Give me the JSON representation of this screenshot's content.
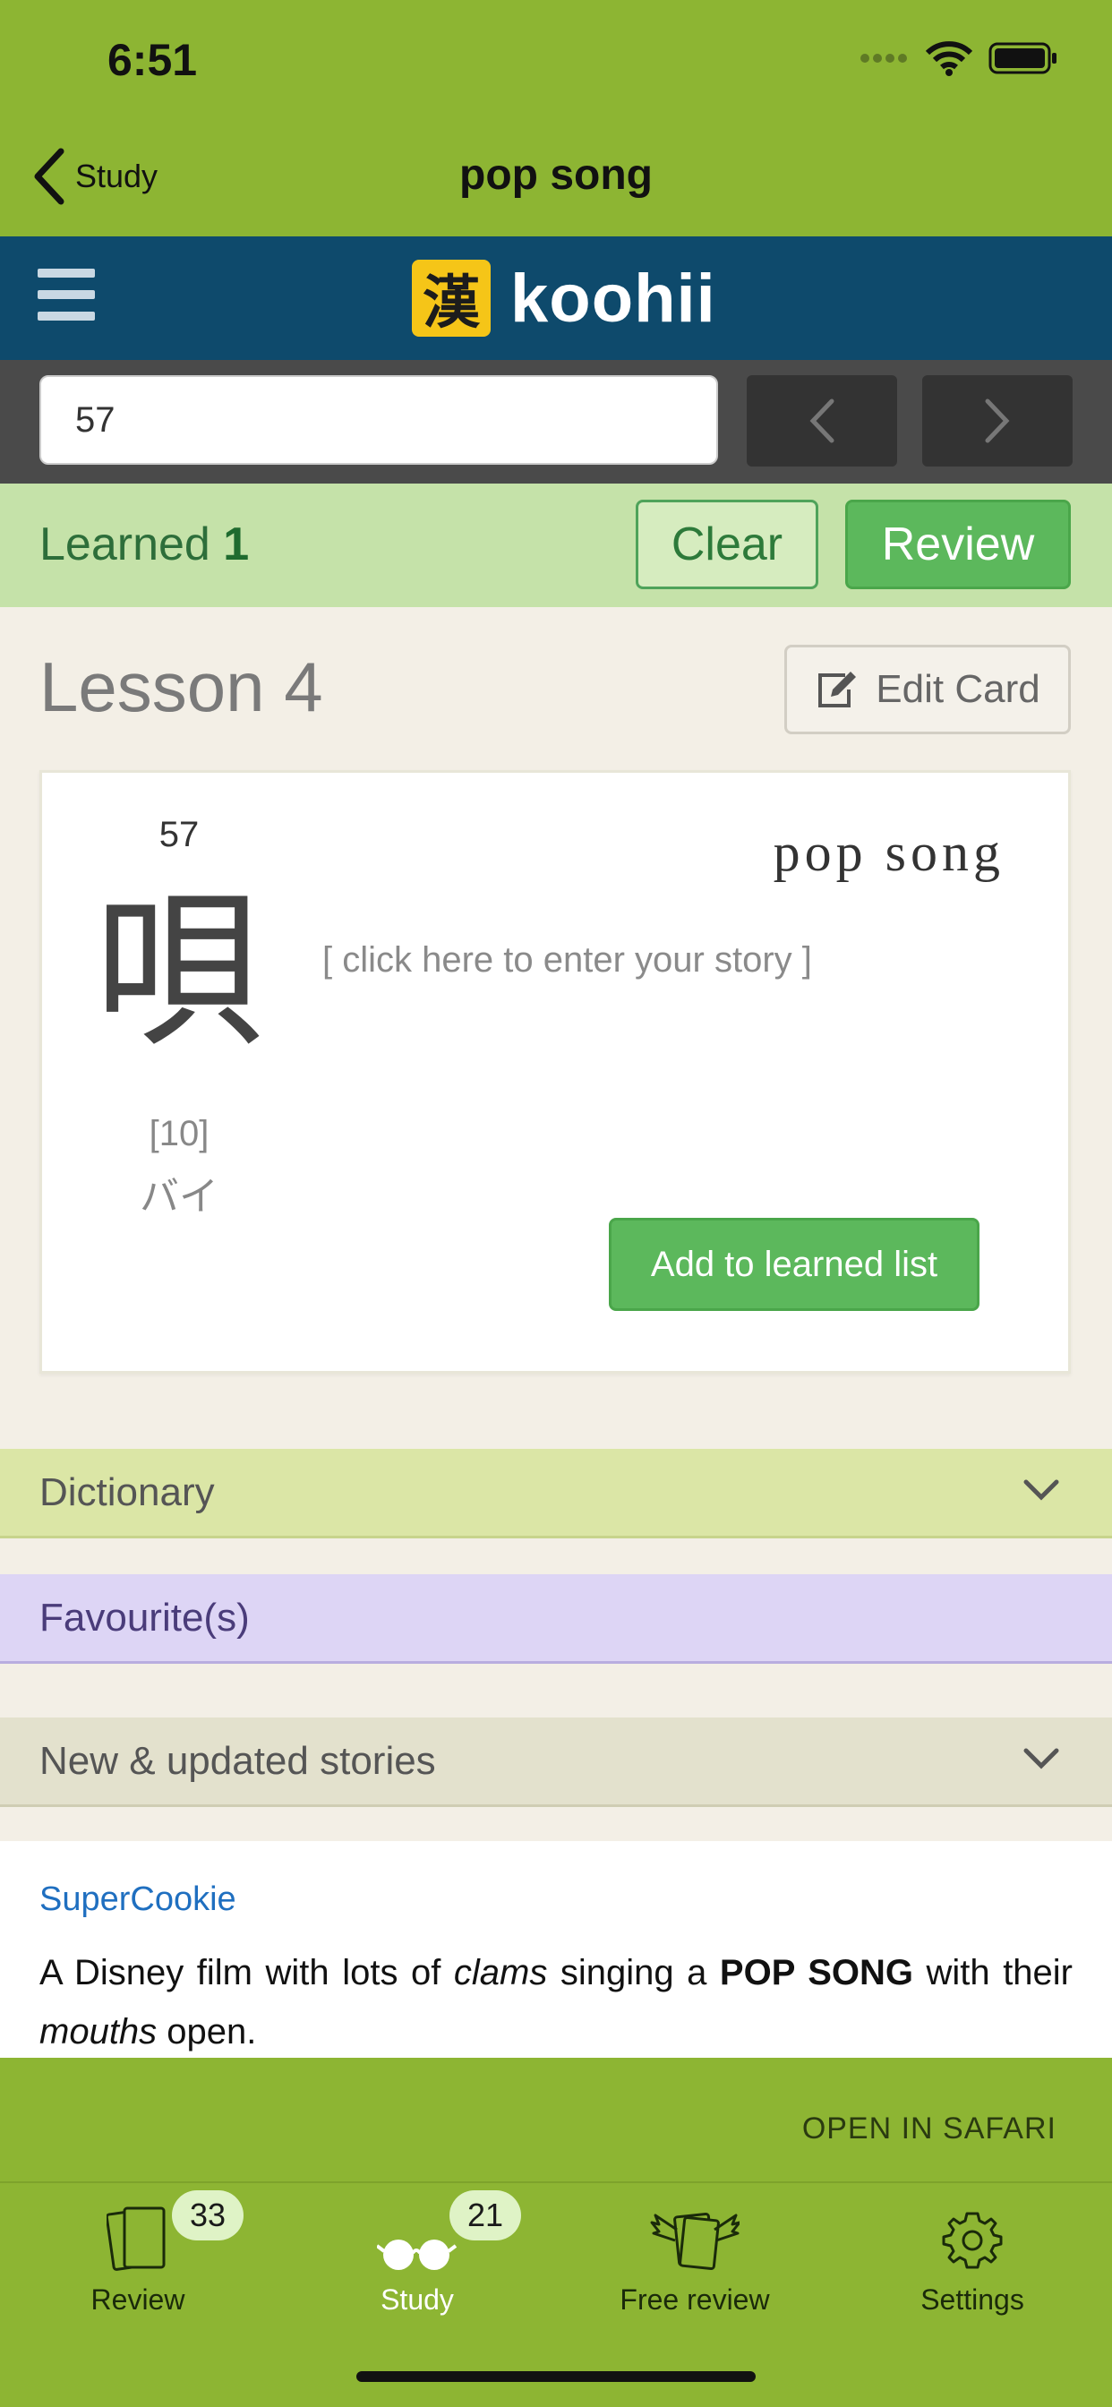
{
  "status_bar": {
    "time": "6:51"
  },
  "nav": {
    "back_label": "Study",
    "title": "pop song"
  },
  "header": {
    "logo_kanji": "漢",
    "logo_text": "koohii"
  },
  "search": {
    "value": "57"
  },
  "learned": {
    "label": "Learned",
    "count": "1",
    "clear_label": "Clear",
    "review_label": "Review"
  },
  "lesson": {
    "title": "Lesson 4",
    "edit_label": "Edit Card"
  },
  "card": {
    "number": "57",
    "kanji": "唄",
    "stroke_count": "[10]",
    "reading": "バイ",
    "keyword": "pop song",
    "story_prompt": "[ click here to enter your story ]",
    "add_label": "Add to learned list"
  },
  "sections": {
    "dictionary": "Dictionary",
    "favourites": "Favourite(s)",
    "stories": "New & updated stories"
  },
  "story": {
    "author": "SuperCookie",
    "text_1": "A Disney film with lots of ",
    "text_2": "clams",
    "text_3": " singing a ",
    "text_4": "POP SONG",
    "text_5": " with their ",
    "text_6": "mouths",
    "text_7": " open."
  },
  "bottom": {
    "open_safari": "OPEN IN SAFARI"
  },
  "tabs": [
    {
      "label": "Review",
      "badge": "33",
      "icon": "cards-icon"
    },
    {
      "label": "Study",
      "badge": "21",
      "icon": "glasses-icon"
    },
    {
      "label": "Free review",
      "icon": "flying-cards-icon"
    },
    {
      "label": "Settings",
      "icon": "gear-icon"
    }
  ],
  "colors": {
    "app_green": "#8db533",
    "koohii_blue": "#0e4a6c",
    "logo_yellow": "#f5c518",
    "button_green": "#5cb85c",
    "learned_bar": "#c5e2a9",
    "dictionary_bar": "#dbe6a6",
    "favourites_bar": "#ddd5f5",
    "link_blue": "#1f6fc0"
  }
}
